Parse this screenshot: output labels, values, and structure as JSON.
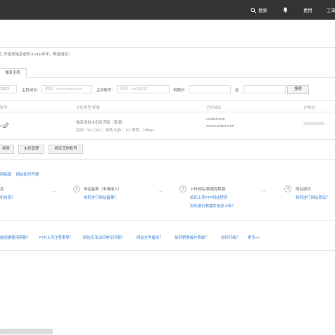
{
  "topbar": {
    "search_label": "搜索",
    "bell_icon": "bell-icon",
    "search_icon": "search-icon",
    "item_3": "费用",
    "item_4": "工单"
  },
  "notice": {
    "text_prefix": "】升级至独享虚机￥149/半年，再送域名！"
  },
  "host_tab": "独享主机",
  "filters": {
    "prefix_value": "5312",
    "domain_label": "主机域名:",
    "domain_placeholder": "例如：mydomain.com",
    "account_label": "主机账号:",
    "account_placeholder": "例如：hm15312",
    "expiry_label": "到期日:",
    "to_label": "至",
    "search_button": "搜索"
  },
  "table": {
    "columns": [
      "账号",
      "主机类型/套餐",
      "主机域名",
      "IP地址"
    ],
    "row": {
      "type_line1": "独享虚拟主机经济版（香港）",
      "type_line2": "空间：5G CPU：单核 内存：1G 带宽：1Mbps",
      "domain_line1": "uedart.com",
      "domain_line2": "www.uedart.com"
    }
  },
  "actions": [
    "续费",
    "主机管理",
    "绑定其他账号"
  ],
  "guide": {
    "title_prefix": "网指南",
    "title_link": "网站如何开通",
    "steps": [
      {
        "num": "",
        "title": "息",
        "link1": "机信息？",
        "link2": ""
      },
      {
        "num": "2",
        "title": "网站备案（申请接入）",
        "link1": "如何进行网站备案？",
        "link2": ""
      },
      {
        "num": "3",
        "title": "上传网站/数据库数据",
        "link1": "如何上传FTP网站程序",
        "link2": "如何进行数据库信息上传？"
      },
      {
        "num": "4",
        "title": "网站调试",
        "link1": "如何进行网站调试？",
        "link2": ""
      }
    ]
  },
  "faq": [
    "能创建使用帮助？",
    "FTP上传注意事项？",
    "网站无法访问常见问题？",
    "网站文件备份？",
    "如何更换操作系统？",
    "如何升级？",
    "更多>>"
  ]
}
